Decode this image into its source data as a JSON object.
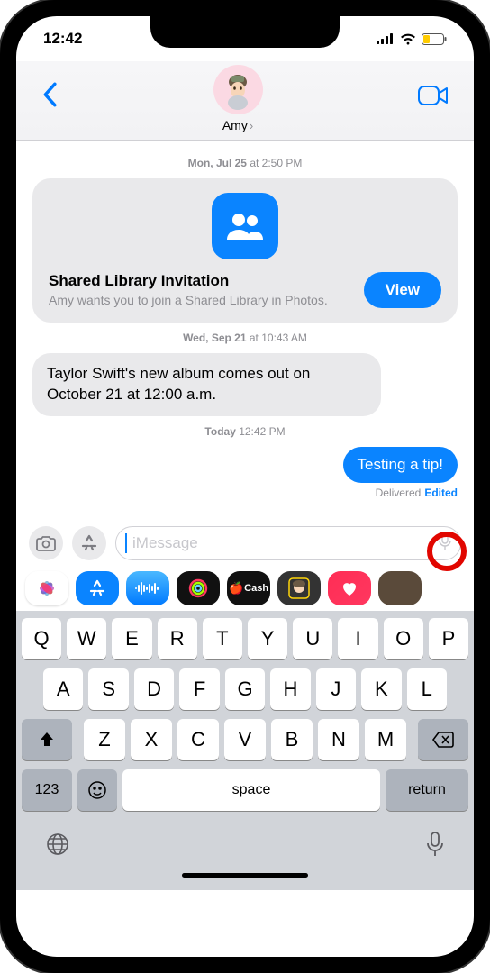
{
  "status": {
    "time": "12:42"
  },
  "header": {
    "contact_name": "Amy"
  },
  "thread": {
    "ts1_day": "Mon, Jul 25",
    "ts1_time": " at 2:50 PM",
    "invite_title": "Shared Library Invitation",
    "invite_subtitle": "Amy wants you to join a Shared Library in Photos.",
    "view_label": "View",
    "ts2_day": "Wed, Sep 21",
    "ts2_time": " at 10:43 AM",
    "msg_in_1": "Taylor Swift's new album comes out on October 21 at 12:00 a.m.",
    "ts3_day": "Today",
    "ts3_time": " 12:42 PM",
    "msg_out_1": "Testing a tip!",
    "delivered": "Delivered",
    "edited": "Edited"
  },
  "input": {
    "placeholder": "iMessage"
  },
  "keyboard": {
    "row1": [
      "Q",
      "W",
      "E",
      "R",
      "T",
      "Y",
      "U",
      "I",
      "O",
      "P"
    ],
    "row2": [
      "A",
      "S",
      "D",
      "F",
      "G",
      "H",
      "J",
      "K",
      "L"
    ],
    "row3": [
      "Z",
      "X",
      "C",
      "V",
      "B",
      "N",
      "M"
    ],
    "numkey": "123",
    "space": "space",
    "return": "return"
  }
}
